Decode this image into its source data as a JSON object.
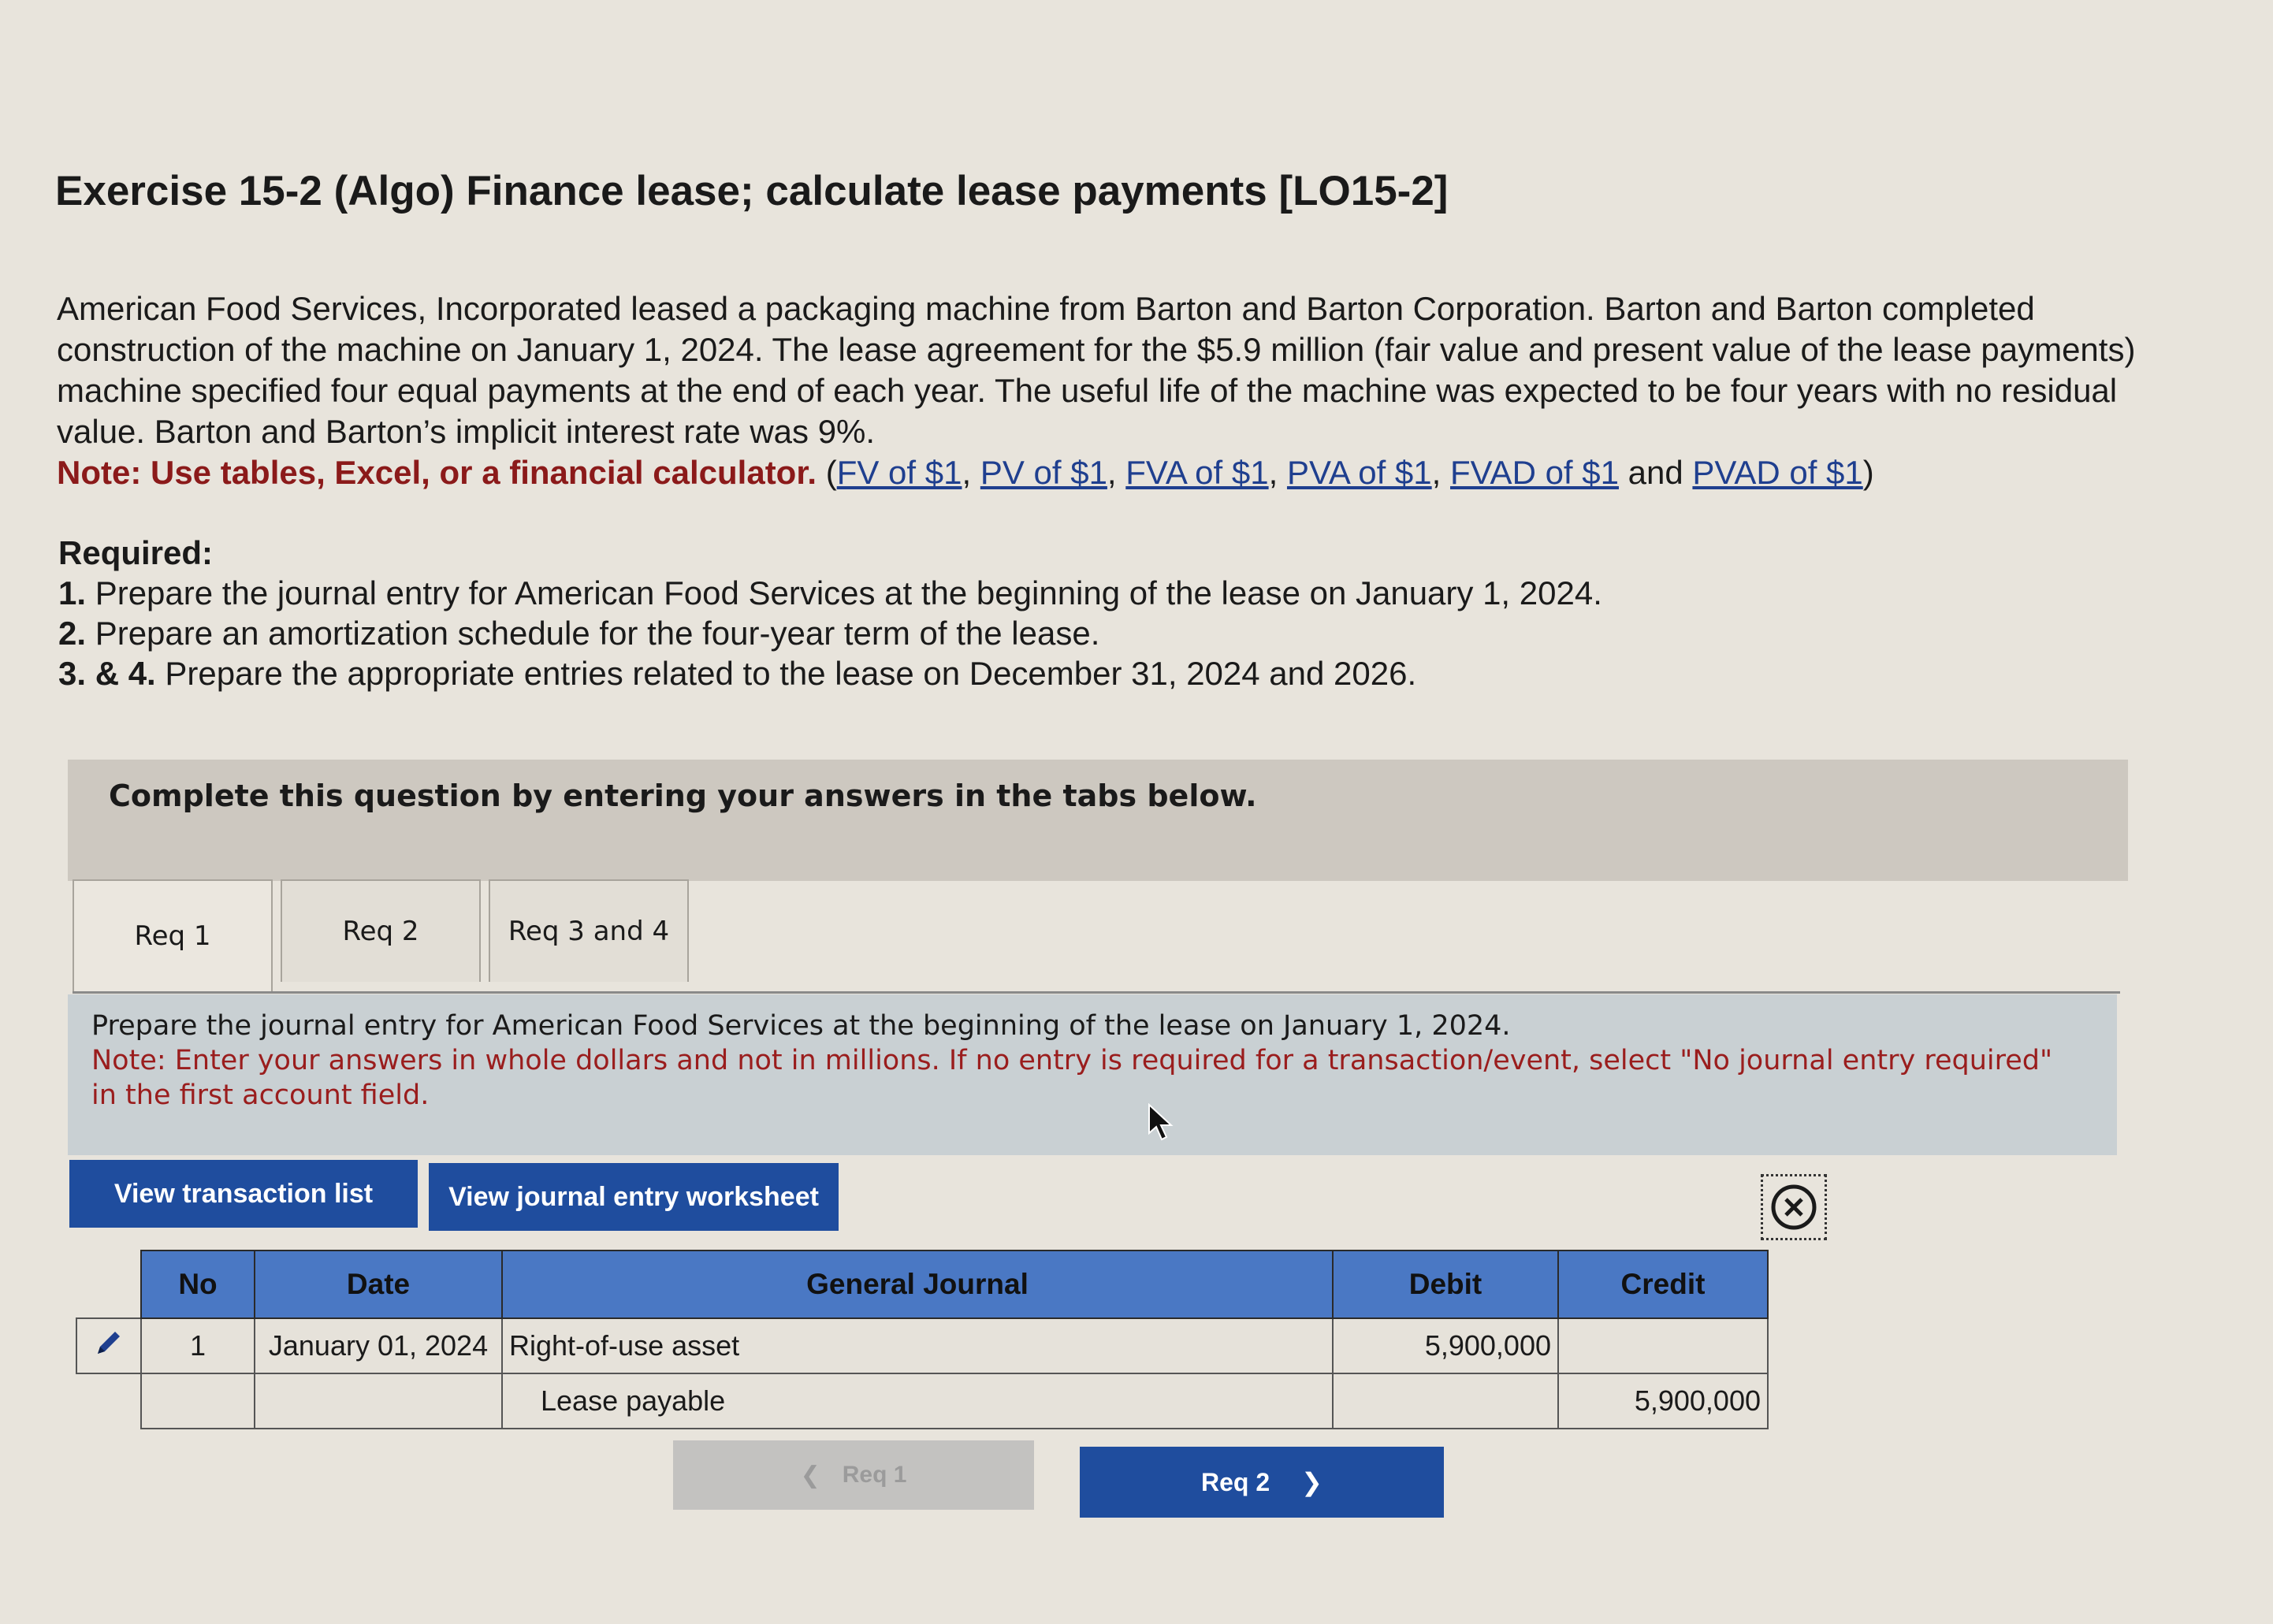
{
  "title": "Exercise 15-2 (Algo) Finance lease; calculate lease payments [LO15-2]",
  "problem": {
    "text": "American Food Services, Incorporated leased a packaging machine from Barton and Barton Corporation. Barton and Barton completed construction of the machine on January 1, 2024. The lease agreement for the $5.9 million (fair value and present value of the lease payments) machine specified four equal payments at the end of each year. The useful life of the machine was expected to be four years with no residual value. Barton and Barton’s implicit interest rate was 9%.",
    "note_label": "Note: Use tables, Excel, or a financial calculator.",
    "links": [
      "FV of $1",
      "PV of $1",
      "FVA of $1",
      "PVA of $1",
      "FVAD of $1",
      "PVAD of $1"
    ],
    "and_word": "and"
  },
  "required": {
    "heading": "Required:",
    "items": [
      {
        "num": "1.",
        "text": "Prepare the journal entry for American Food Services at the beginning of the lease on January 1, 2024."
      },
      {
        "num": "2.",
        "text": "Prepare an amortization schedule for the four-year term of the lease."
      },
      {
        "num": "3. & 4.",
        "text": "Prepare the appropriate entries related to the lease on December 31, 2024 and 2026."
      }
    ]
  },
  "banner": "Complete this question by entering your answers in the tabs below.",
  "tabs": [
    {
      "label": "Req 1",
      "active": true
    },
    {
      "label": "Req 2",
      "active": false
    },
    {
      "label": "Req 3 and 4",
      "active": false
    }
  ],
  "instruction": {
    "main": "Prepare the journal entry for American Food Services at the beginning of the lease on January 1, 2024.",
    "note": "Note: Enter your answers in whole dollars and not in millions. If no entry is required for a transaction/event, select \"No journal entry required\" in the first account field."
  },
  "buttons": {
    "view_transactions": "View transaction list",
    "view_worksheet": "View journal entry worksheet"
  },
  "journal": {
    "headers": {
      "no": "No",
      "date": "Date",
      "general_journal": "General Journal",
      "debit": "Debit",
      "credit": "Credit"
    },
    "rows": [
      {
        "no": "1",
        "date": "January 01, 2024",
        "account": "Right-of-use asset",
        "debit": "5,900,000",
        "credit": ""
      },
      {
        "no": "",
        "date": "",
        "account": "Lease payable",
        "debit": "",
        "credit": "5,900,000"
      }
    ]
  },
  "nav": {
    "prev": "Req 1",
    "next": "Req 2"
  },
  "colors": {
    "accent_blue": "#1f4d9e",
    "header_blue": "#4a78c4",
    "note_red": "#8b1a1a"
  }
}
